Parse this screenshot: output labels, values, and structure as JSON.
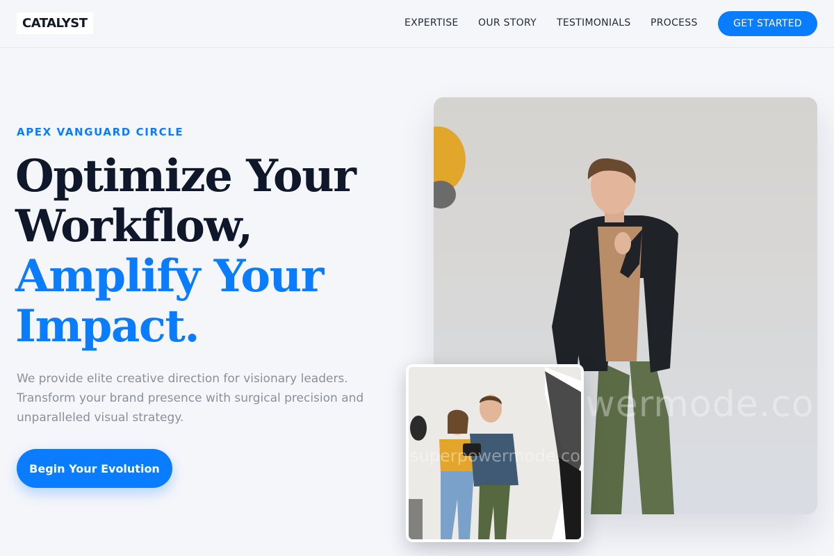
{
  "header": {
    "logo": "CATALYST",
    "nav": [
      "EXPERTISE",
      "OUR STORY",
      "TESTIMONIALS",
      "PROCESS"
    ],
    "cta_label": "GET STARTED"
  },
  "hero": {
    "eyebrow": "APEX VANGUARD CIRCLE",
    "headline_dark": [
      "Optimize Your",
      "Workflow,"
    ],
    "headline_blue": [
      "Amplify Your",
      "Impact."
    ],
    "description": "We provide elite creative direction for visionary leaders. Transform your brand presence with surgical precision and unparalleled visual strategy.",
    "cta_label": "Begin Your Evolution"
  },
  "images": {
    "main_watermark": "superpowermode.com",
    "inset_watermark": "superpowermode.com"
  },
  "colors": {
    "accent": "#0a7cff",
    "heading": "#0f172a",
    "body_text": "#8a8f9a",
    "background": "#f5f6fa"
  }
}
